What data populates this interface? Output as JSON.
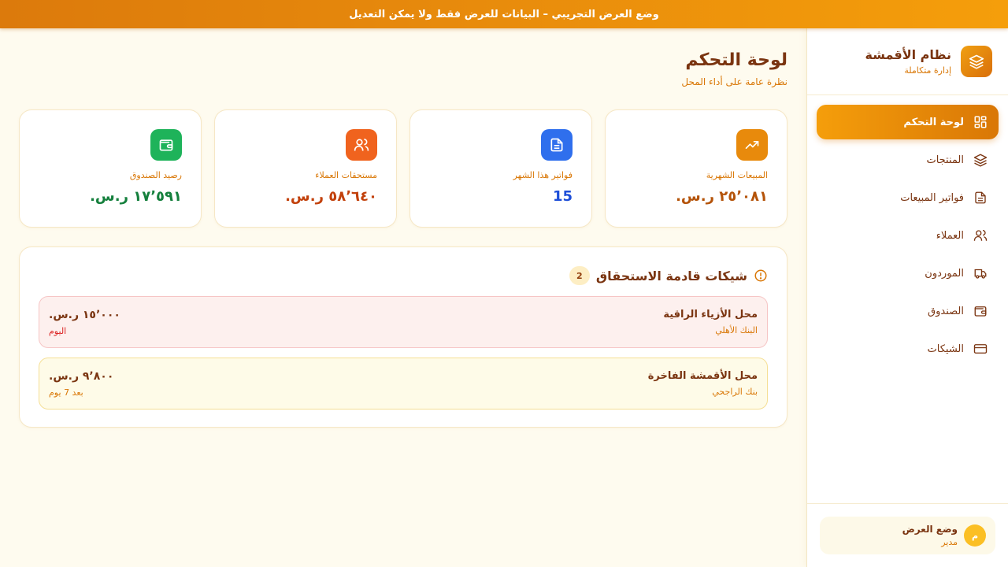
{
  "banner": {
    "text": "وضع العرض التجريبي – البيانات للعرض فقط ولا يمكن التعديل",
    "gradient_from": "#dc7a0c",
    "gradient_to": "#f59e0b"
  },
  "brand": {
    "title": "نظام الأقمشة",
    "subtitle": "إدارة متكاملة",
    "icon": "layers-icon"
  },
  "nav": {
    "items": [
      {
        "label": "لوحة التحكم",
        "icon": "dashboard-icon",
        "active": true
      },
      {
        "label": "المنتجات",
        "icon": "layers-icon",
        "active": false
      },
      {
        "label": "فواتير المبيعات",
        "icon": "document-icon",
        "active": false
      },
      {
        "label": "العملاء",
        "icon": "users-icon",
        "active": false
      },
      {
        "label": "الموردون",
        "icon": "truck-icon",
        "active": false
      },
      {
        "label": "الصندوق",
        "icon": "wallet-icon",
        "active": false
      },
      {
        "label": "الشيكات",
        "icon": "card-icon",
        "active": false
      }
    ]
  },
  "user": {
    "avatar": "م",
    "name": "وضع العرض",
    "role": "مدير"
  },
  "page": {
    "title": "لوحة التحكم",
    "subtitle": "نظرة عامة على أداء المحل"
  },
  "stats": [
    {
      "label": "المبيعات الشهرية",
      "value": "٢٥٬٠٨١ ر.س.",
      "icon": "trend-up-icon",
      "color": "#e88a0c"
    },
    {
      "label": "فواتير هذا الشهر",
      "value": "15",
      "icon": "document-icon",
      "color": "#2f6fed"
    },
    {
      "label": "مستحقات العملاء",
      "value": "٥٨٬٦٤٠ ر.س.",
      "icon": "users-icon",
      "color": "#f0631e"
    },
    {
      "label": "رصيد الصندوق",
      "value": "١٧٬٥٩١ ر.س.",
      "icon": "wallet-icon",
      "color": "#1eb35a"
    }
  ],
  "cheques": {
    "title": "شيكات قادمة الاستحقاق",
    "count": "2",
    "items": [
      {
        "name": "محل الأزياء الراقية",
        "bank": "البنك الأهلي",
        "amount": "١٥٬٠٠٠ ر.س.",
        "when": "اليوم",
        "tone": "red"
      },
      {
        "name": "محل الأقمشة الفاخرة",
        "bank": "بنك الراجحي",
        "amount": "٩٬٨٠٠ ر.س.",
        "when": "بعد 7 يوم",
        "tone": "amber"
      }
    ]
  }
}
